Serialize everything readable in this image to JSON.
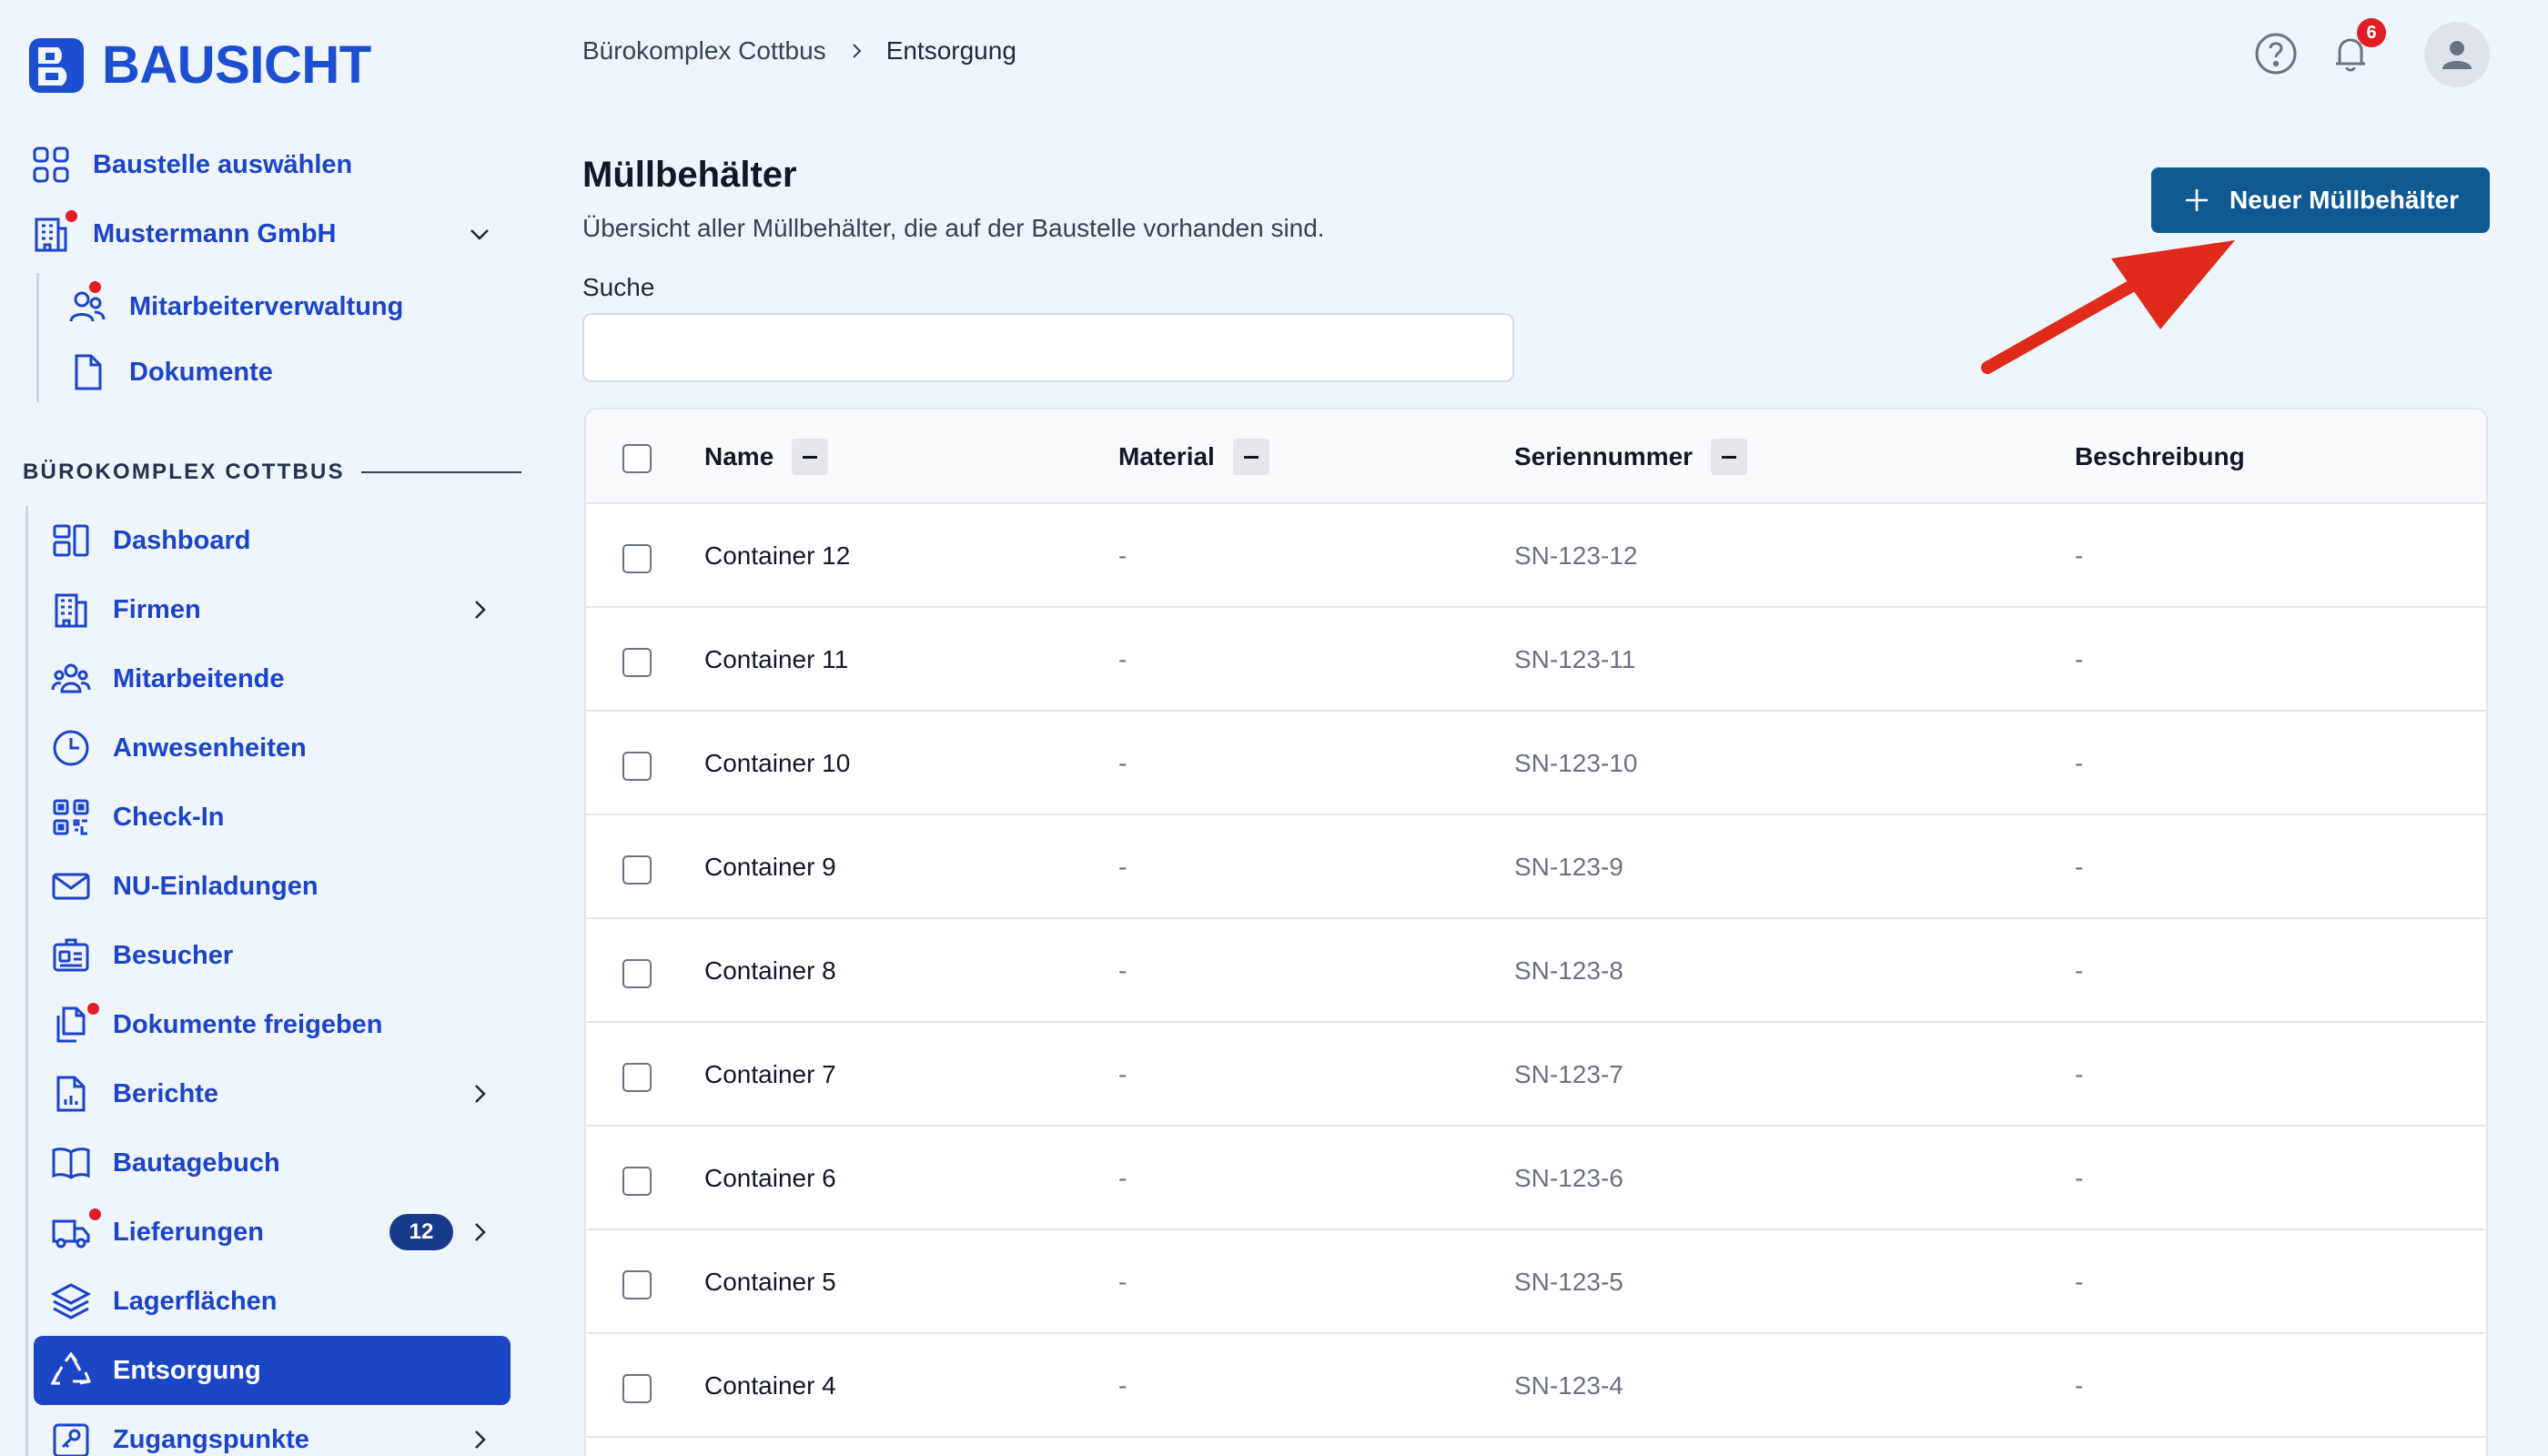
{
  "brand": {
    "name": "BAUSICHT",
    "color": "#1c4ed1"
  },
  "sidebar": {
    "top_items": [
      {
        "label": "Baustelle auswählen",
        "icon": "grid-icon"
      },
      {
        "label": "Mustermann GmbH",
        "icon": "building-icon"
      },
      {
        "label": "Mitarbeiterverwaltung",
        "icon": "users-icon"
      },
      {
        "label": "Dokumente",
        "icon": "document-icon"
      }
    ],
    "section_title": "BÜROKOMPLEX COTTBUS",
    "items": [
      {
        "label": "Dashboard",
        "icon": "dashboard-icon"
      },
      {
        "label": "Firmen",
        "icon": "office-building-icon"
      },
      {
        "label": "Mitarbeitende",
        "icon": "user-group-icon"
      },
      {
        "label": "Anwesenheiten",
        "icon": "clock-icon"
      },
      {
        "label": "Check-In",
        "icon": "qr-code-icon"
      },
      {
        "label": "NU-Einladungen",
        "icon": "envelope-icon"
      },
      {
        "label": "Besucher",
        "icon": "id-card-icon"
      },
      {
        "label": "Dokumente freigeben",
        "icon": "documents-icon"
      },
      {
        "label": "Berichte",
        "icon": "report-icon"
      },
      {
        "label": "Bautagebuch",
        "icon": "book-icon"
      },
      {
        "label": "Lieferungen",
        "icon": "truck-icon",
        "badge": "12"
      },
      {
        "label": "Lagerflächen",
        "icon": "layers-icon"
      },
      {
        "label": "Entsorgung",
        "icon": "recycle-icon"
      },
      {
        "label": "Zugangspunkte",
        "icon": "key-icon"
      }
    ]
  },
  "header": {
    "breadcrumb": [
      "Bürokomplex Cottbus",
      "Entsorgung"
    ],
    "notification_count": "6"
  },
  "main": {
    "title": "Müllbehälter",
    "subtitle": "Übersicht aller Müllbehälter, die auf der Baustelle vorhanden sind.",
    "new_button_label": "Neuer Müllbehälter",
    "search": {
      "label": "Suche",
      "value": "",
      "placeholder": ""
    },
    "columns": [
      "Name",
      "Material",
      "Seriennummer",
      "Beschreibung"
    ],
    "rows": [
      {
        "name": "Container 12",
        "material": "-",
        "serial": "SN-123-12",
        "description": "-"
      },
      {
        "name": "Container 11",
        "material": "-",
        "serial": "SN-123-11",
        "description": "-"
      },
      {
        "name": "Container 10",
        "material": "-",
        "serial": "SN-123-10",
        "description": "-"
      },
      {
        "name": "Container 9",
        "material": "-",
        "serial": "SN-123-9",
        "description": "-"
      },
      {
        "name": "Container 8",
        "material": "-",
        "serial": "SN-123-8",
        "description": "-"
      },
      {
        "name": "Container 7",
        "material": "-",
        "serial": "SN-123-7",
        "description": "-"
      },
      {
        "name": "Container 6",
        "material": "-",
        "serial": "SN-123-6",
        "description": "-"
      },
      {
        "name": "Container 5",
        "material": "-",
        "serial": "SN-123-5",
        "description": "-"
      },
      {
        "name": "Container 4",
        "material": "-",
        "serial": "SN-123-4",
        "description": "-"
      }
    ]
  },
  "colors": {
    "accent": "#1c45c3",
    "primary_button": "#0f5a93",
    "alert_dot": "#e11d25",
    "annotation_arrow": "#e02b1b"
  }
}
